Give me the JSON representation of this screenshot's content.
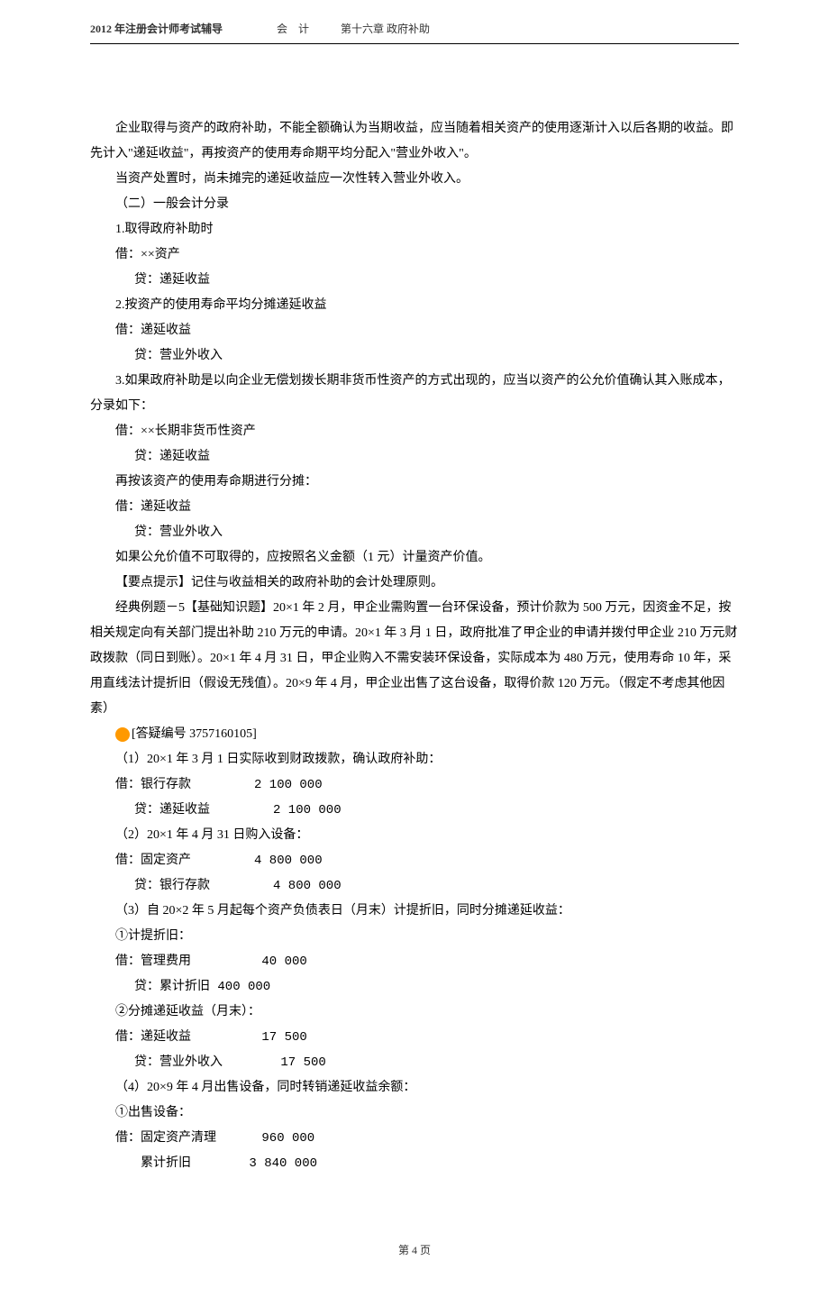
{
  "header": {
    "left": "2012 年注册会计师考试辅导",
    "mid": "会　计",
    "right": "第十六章 政府补助"
  },
  "paragraphs": {
    "p1": "企业取得与资产的政府补助，不能全额确认为当期收益，应当随着相关资产的使用逐渐计入以后各期的收益。即先计入\"递延收益\"，再按资产的使用寿命期平均分配入\"营业外收入\"。",
    "p2": "当资产处置时，尚未摊完的递延收益应一次性转入营业外收入。",
    "p3": "（二）一般会计分录",
    "p4": "1.取得政府补助时",
    "p5": "借：××资产",
    "p6": "贷：递延收益",
    "p7": "2.按资产的使用寿命平均分摊递延收益",
    "p8": "借：递延收益",
    "p9": "贷：营业外收入",
    "p10": "3.如果政府补助是以向企业无偿划拨长期非货币性资产的方式出现的，应当以资产的公允价值确认其入账成本，分录如下：",
    "p11": "借：××长期非货币性资产",
    "p12": "贷：递延收益",
    "p13": "再按该资产的使用寿命期进行分摊：",
    "p14": "借：递延收益",
    "p15": "贷：营业外收入",
    "p16": "如果公允价值不可取得的，应按照名义金额（1 元）计量资产价值。",
    "p17": "【要点提示】记住与收益相关的政府补助的会计处理原则。",
    "p18": "经典例题－5【基础知识题】20×1 年 2 月，甲企业需购置一台环保设备，预计价款为 500 万元，因资金不足，按相关规定向有关部门提出补助 210 万元的申请。20×1 年 3 月 1 日，政府批准了甲企业的申请并拨付甲企业 210 万元财政拨款（同日到账）。20×1 年 4 月 31 日，甲企业购入不需安装环保设备，实际成本为 480 万元，使用寿命 10 年，采用直线法计提折旧（假设无残值）。20×9 年 4 月，甲企业出售了这台设备，取得价款 120 万元。（假定不考虑其他因素）",
    "p19": "[答疑编号 3757160105]",
    "p20": "（1）20×1 年 3 月 1 日实际收到财政拨款，确认政府补助：",
    "p21": "借：银行存款　　　　　2 100 000",
    "p22": "贷：递延收益　　　　　2 100 000",
    "p23": "（2）20×1 年 4 月 31 日购入设备：",
    "p24": "借：固定资产　　　　　4 800 000",
    "p25": "贷：银行存款　　　　　4 800 000",
    "p26": "（3）自 20×2 年 5 月起每个资产负债表日（月末）计提折旧，同时分摊递延收益：",
    "p27": "①计提折旧：",
    "p28": "借：管理费用　　　　　 40 000",
    "p29": "贷：累计折旧 400 000",
    "p30": "②分摊递延收益（月末）：",
    "p31": "借：递延收益　　　　　 17 500",
    "p32": "贷：营业外收入　　　　 17 500",
    "p33": "（4）20×9 年 4 月出售设备，同时转销递延收益余额：",
    "p34": "①出售设备：",
    "p35": "借：固定资产清理　　　 960 000",
    "p36": "　　累计折旧　　　　 3 840 000"
  },
  "footer": {
    "page_label": "第 4 页"
  }
}
